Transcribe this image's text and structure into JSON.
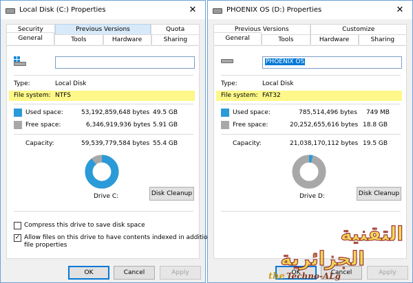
{
  "left": {
    "title": "Local Disk (C:) Properties",
    "tabs_row1": [
      "Security",
      "Previous Versions",
      "Quota"
    ],
    "tabs_row2": [
      "General",
      "Tools",
      "Hardware",
      "Sharing"
    ],
    "name_value": "",
    "type_label": "Type:",
    "type_value": "Local Disk",
    "fs_label": "File system:",
    "fs_value": "NTFS",
    "used_label": "Used space:",
    "used_bytes": "53,192,859,648 bytes",
    "used_gb": "49.5 GB",
    "free_label": "Free space:",
    "free_bytes": "6,346,919,936 bytes",
    "free_gb": "5.91 GB",
    "capacity_label": "Capacity:",
    "capacity_bytes": "59,539,779,584 bytes",
    "capacity_gb": "55.4 GB",
    "used_fraction": 0.893,
    "drive_label": "Drive C:",
    "cleanup_label": "Disk Cleanup",
    "compress_label": "Compress this drive to save disk space",
    "compress_checked": false,
    "index_label_1": "Allow files on this drive to have contents indexed in addition to",
    "index_label_2": "file properties",
    "index_checked": true,
    "ok_label": "OK",
    "cancel_label": "Cancel",
    "apply_label": "Apply"
  },
  "right": {
    "title": "PHOENIX OS (D:) Properties",
    "tabs_row1": [
      "Previous Versions",
      "Customize"
    ],
    "tabs_row2": [
      "General",
      "Tools",
      "Hardware",
      "Sharing"
    ],
    "name_value": "PHOENIX OS",
    "type_label": "Type:",
    "type_value": "Local Disk",
    "fs_label": "File system:",
    "fs_value": "FAT32",
    "used_label": "Used space:",
    "used_bytes": "785,514,496 bytes",
    "used_gb": "749 MB",
    "free_label": "Free space:",
    "free_bytes": "20,252,655,616 bytes",
    "free_gb": "18.8 GB",
    "capacity_label": "Capacity:",
    "capacity_bytes": "21,038,170,112 bytes",
    "capacity_gb": "19.5 GB",
    "used_fraction": 0.037,
    "drive_label": "Drive D:",
    "cleanup_label": "Disk Cleanup",
    "ok_label": "OK",
    "cancel_label": "Cancel",
    "apply_label": "Apply"
  },
  "watermark": {
    "arabic_line1": "التقنية",
    "arabic_line2": "الجزائرية",
    "brand_the": "the",
    "brand_name": "Techno-ALg"
  },
  "colors": {
    "used": "#2a9ad8",
    "free": "#a8a8a8",
    "highlight": "#fdf889",
    "selection": "#0078d7"
  },
  "icons": {
    "title_icon": "drive-icon",
    "close_icon": "close-icon",
    "windows_logo": "windows-logo-icon"
  }
}
